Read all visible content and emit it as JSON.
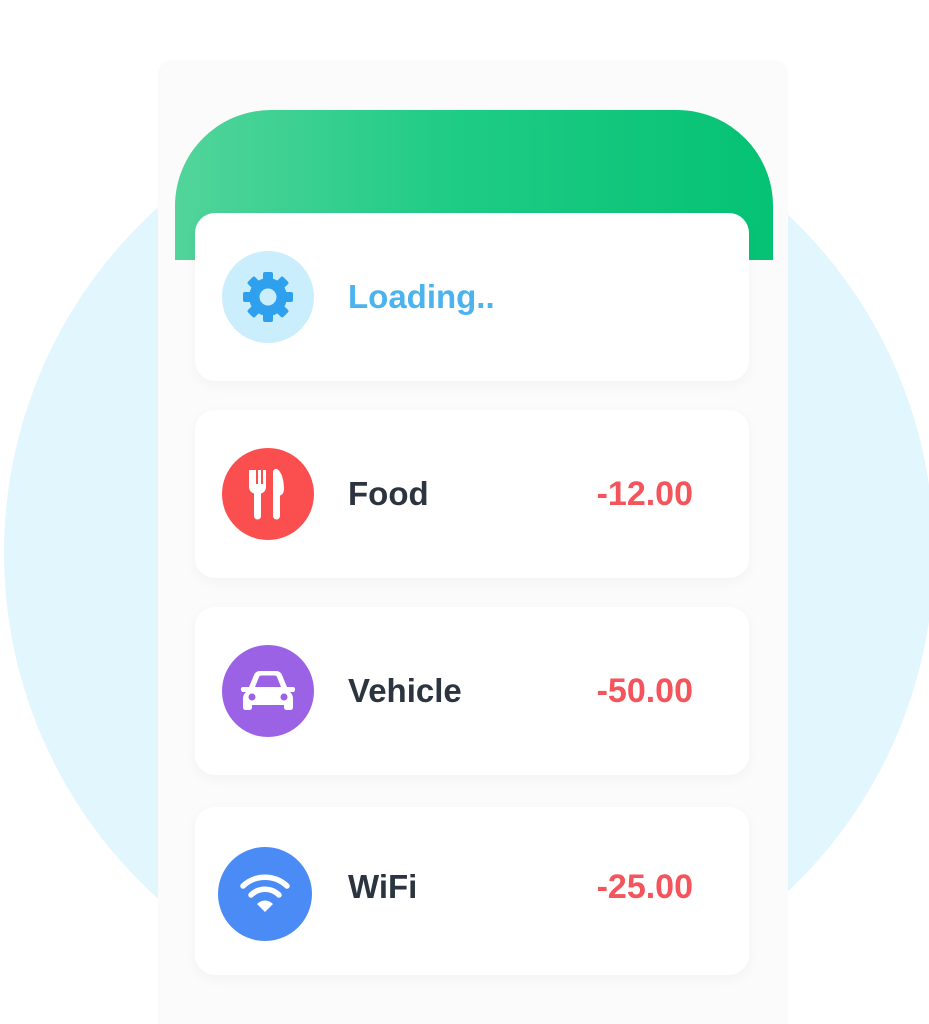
{
  "loading": {
    "text": "Loading..",
    "icon": "gear-icon",
    "icon_bg": "#caeefc",
    "icon_color": "#2ea0ee",
    "text_color": "#4bb3ee"
  },
  "transactions": [
    {
      "label": "Food",
      "amount": "-12.00",
      "icon": "fork-knife-icon",
      "icon_bg": "#fb4f4f"
    },
    {
      "label": "Vehicle",
      "amount": "-50.00",
      "icon": "car-icon",
      "icon_bg": "#9c62e6"
    },
    {
      "label": "WiFi",
      "amount": "-25.00",
      "icon": "wifi-icon",
      "icon_bg": "#4b8bf6"
    }
  ],
  "colors": {
    "header_start": "#52d49b",
    "header_end": "#05c274",
    "amount": "#f4545c",
    "label": "#2c3440",
    "background_circle": "#e2f6fd"
  }
}
